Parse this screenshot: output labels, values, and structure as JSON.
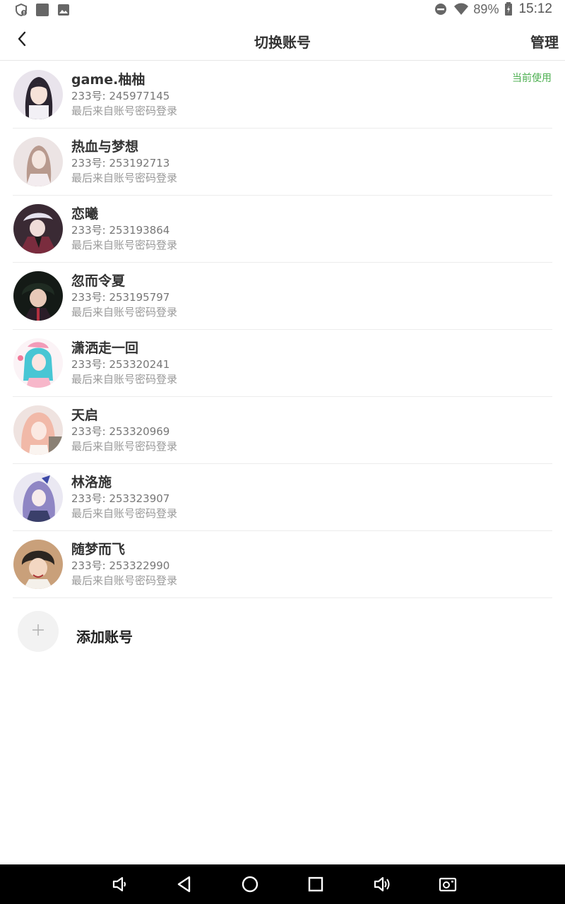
{
  "status_bar": {
    "battery": "89%",
    "time": "15:12",
    "left_icons": [
      "shield-alert-icon",
      "square-app-icon",
      "image-icon"
    ],
    "right_icons": [
      "do-not-disturb-icon",
      "wifi-icon",
      "battery-icon"
    ]
  },
  "header": {
    "title": "切换账号",
    "manage_label": "管理",
    "back_icon": "chevron-left-icon"
  },
  "accounts": [
    {
      "name": "game.柚柚",
      "uid": "233号: 245977145",
      "last_login": "最后来自账号密码登录",
      "current": "当前使用"
    },
    {
      "name": "热血与梦想",
      "uid": "233号: 253192713",
      "last_login": "最后来自账号密码登录"
    },
    {
      "name": "恋曦",
      "uid": "233号: 253193864",
      "last_login": "最后来自账号密码登录"
    },
    {
      "name": "忽而令夏",
      "uid": "233号: 253195797",
      "last_login": "最后来自账号密码登录"
    },
    {
      "name": "潇洒走一回",
      "uid": "233号: 253320241",
      "last_login": "最后来自账号密码登录"
    },
    {
      "name": "天启",
      "uid": "233号: 253320969",
      "last_login": "最后来自账号密码登录"
    },
    {
      "name": "林洛施",
      "uid": "233号: 253323907",
      "last_login": "最后来自账号密码登录"
    },
    {
      "name": "随梦而飞",
      "uid": "233号: 253322990",
      "last_login": "最后来自账号密码登录"
    }
  ],
  "add_account": {
    "label": "添加账号",
    "icon": "plus-icon"
  },
  "nav_bar": {
    "icons": [
      "volume-down-icon",
      "back-triangle-icon",
      "home-circle-icon",
      "recents-square-icon",
      "volume-up-icon",
      "screenshot-icon"
    ]
  },
  "colors": {
    "accent_green": "#4caf50",
    "divider": "#ececec",
    "nav_bg": "#000000"
  }
}
